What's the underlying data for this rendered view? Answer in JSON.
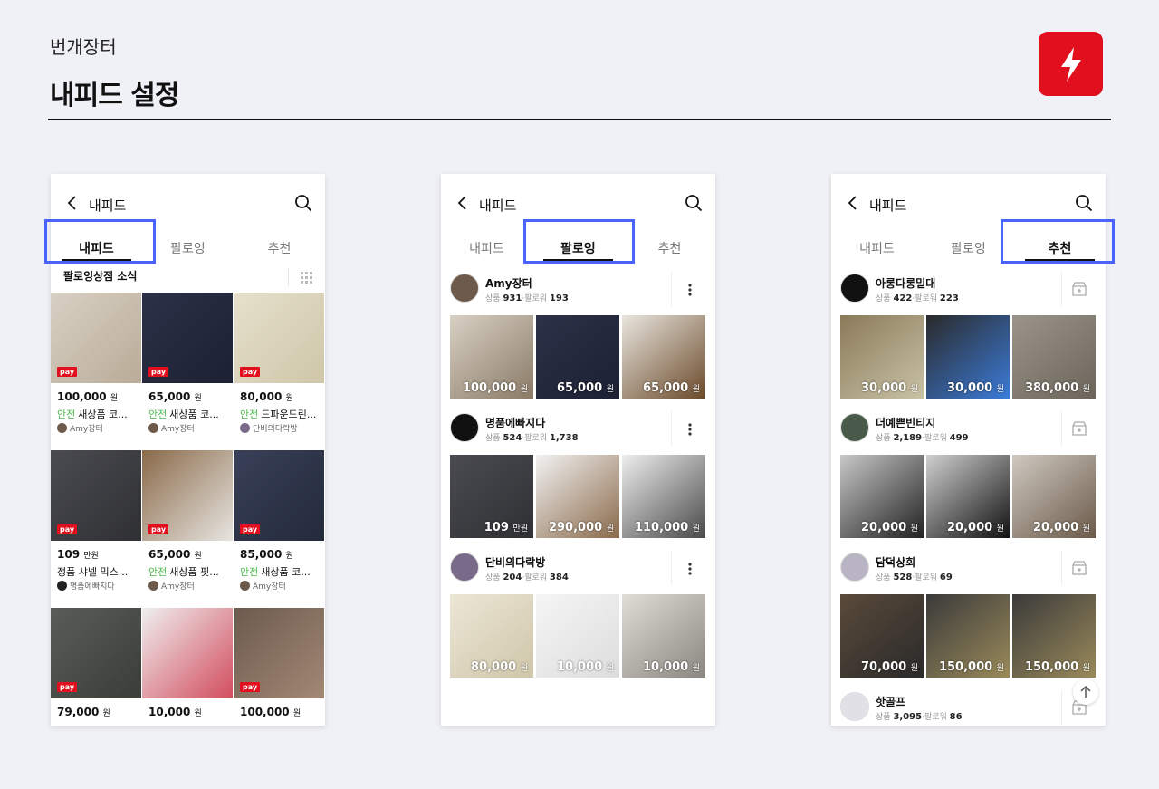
{
  "brand": "번개장터",
  "page_title": "내피드 설정",
  "colors": {
    "accent": "#e2101e",
    "highlight": "#4a63ff",
    "safe": "#4db84d"
  },
  "phone_header": "내피드",
  "tabs": [
    "내피드",
    "팔로잉",
    "추천"
  ],
  "feed": {
    "section_title": "팔로잉상점 소식",
    "products": [
      {
        "price": "100,000",
        "unit": "원",
        "safe": "안전",
        "name": "새상품 코...",
        "seller": "Amy장터",
        "pay": "pay"
      },
      {
        "price": "65,000",
        "unit": "원",
        "safe": "안전",
        "name": "새상품 코...",
        "seller": "Amy장터",
        "pay": "pay"
      },
      {
        "price": "80,000",
        "unit": "원",
        "safe": "안전",
        "name": "드파운드린...",
        "seller": "단비의다락방",
        "pay": "pay"
      },
      {
        "price": "109",
        "unit": "만원",
        "safe": "",
        "name": "정품 샤넬 믹스...",
        "seller": "명품에빠지다",
        "pay": "pay"
      },
      {
        "price": "65,000",
        "unit": "원",
        "safe": "안전",
        "name": "새상품 핏...",
        "seller": "Amy장터",
        "pay": "pay"
      },
      {
        "price": "85,000",
        "unit": "원",
        "safe": "안전",
        "name": "새상품 코...",
        "seller": "Amy장터",
        "pay": "pay"
      },
      {
        "price": "79,000",
        "unit": "원",
        "safe": "",
        "name": "",
        "seller": "",
        "pay": "pay"
      },
      {
        "price": "10,000",
        "unit": "원",
        "safe": "",
        "name": "",
        "seller": "",
        "pay": ""
      },
      {
        "price": "100,000",
        "unit": "원",
        "safe": "",
        "name": "",
        "seller": "",
        "pay": "pay"
      }
    ]
  },
  "following": {
    "stores": [
      {
        "name": "Amy장터",
        "product_label": "상품",
        "products": "931",
        "follower_label": "팔로워",
        "followers": "193",
        "items": [
          {
            "price": "100,000",
            "unit": "원"
          },
          {
            "price": "65,000",
            "unit": "원"
          },
          {
            "price": "65,000",
            "unit": "원"
          }
        ]
      },
      {
        "name": "명품에빠지다",
        "product_label": "상품",
        "products": "524",
        "follower_label": "팔로워",
        "followers": "1,738",
        "items": [
          {
            "price": "109",
            "unit": "만원"
          },
          {
            "price": "290,000",
            "unit": "원"
          },
          {
            "price": "110,000",
            "unit": "원"
          }
        ]
      },
      {
        "name": "단비의다락방",
        "product_label": "상품",
        "products": "204",
        "follower_label": "팔로워",
        "followers": "384",
        "items": [
          {
            "price": "80,000",
            "unit": "원"
          },
          {
            "price": "10,000",
            "unit": "원"
          },
          {
            "price": "10,000",
            "unit": "원"
          }
        ]
      }
    ]
  },
  "recommend": {
    "stores": [
      {
        "name": "아롱다롱밀대",
        "product_label": "상품",
        "products": "422",
        "follower_label": "팔로워",
        "followers": "223",
        "items": [
          {
            "price": "30,000",
            "unit": "원"
          },
          {
            "price": "30,000",
            "unit": "원"
          },
          {
            "price": "380,000",
            "unit": "원"
          }
        ]
      },
      {
        "name": "더예쁜빈티지",
        "product_label": "상품",
        "products": "2,189",
        "follower_label": "팔로워",
        "followers": "499",
        "items": [
          {
            "price": "20,000",
            "unit": "원"
          },
          {
            "price": "20,000",
            "unit": "원"
          },
          {
            "price": "20,000",
            "unit": "원"
          }
        ]
      },
      {
        "name": "담덕상회",
        "product_label": "상품",
        "products": "528",
        "follower_label": "팔로워",
        "followers": "69",
        "items": [
          {
            "price": "70,000",
            "unit": "원"
          },
          {
            "price": "150,000",
            "unit": "원"
          },
          {
            "price": "150,000",
            "unit": "원"
          }
        ]
      },
      {
        "name": "핫골프",
        "product_label": "상품",
        "products": "3,095",
        "follower_label": "팔로워",
        "followers": "86",
        "items": []
      }
    ]
  }
}
